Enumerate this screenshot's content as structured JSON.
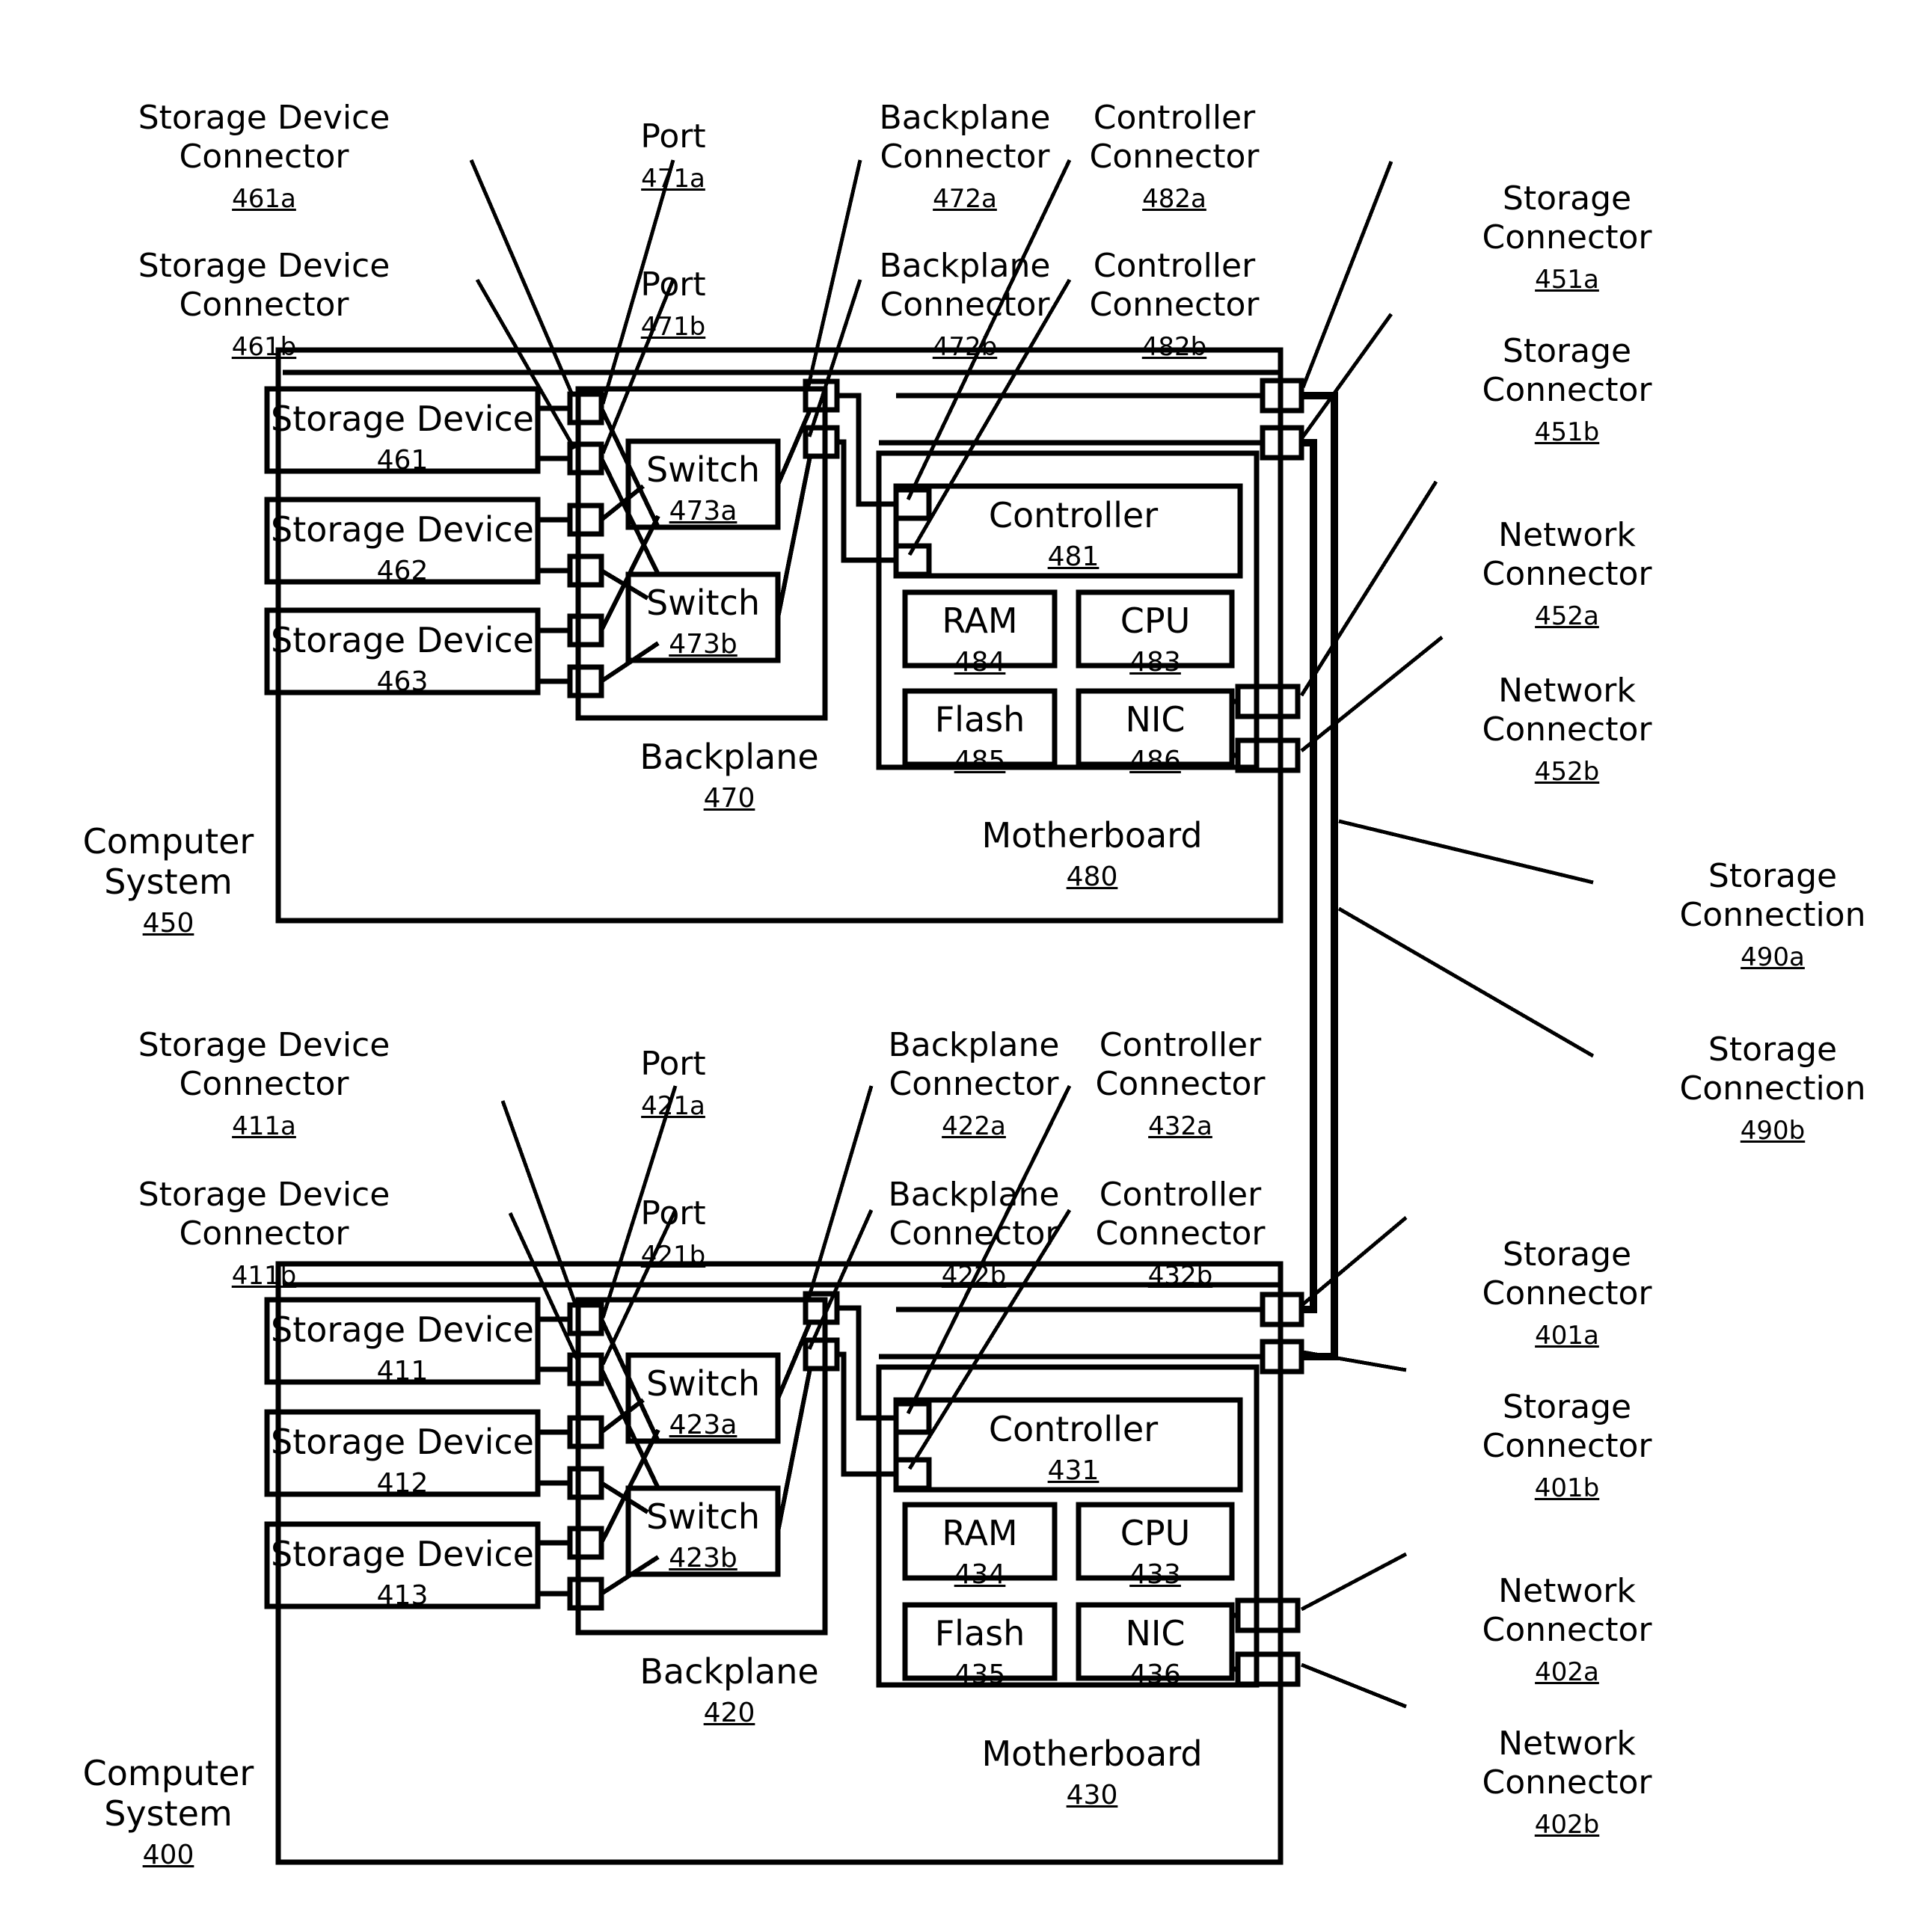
{
  "diagram": {
    "systems": [
      {
        "id": "system-450",
        "caption": "Computer\nSystem",
        "number": "450",
        "storage_devices": [
          {
            "label": "Storage Device",
            "number": "461"
          },
          {
            "label": "Storage Device",
            "number": "462"
          },
          {
            "label": "Storage Device",
            "number": "463"
          }
        ],
        "switches": [
          {
            "label": "Switch",
            "number": "473a"
          },
          {
            "label": "Switch",
            "number": "473b"
          }
        ],
        "backplane": {
          "label": "Backplane",
          "number": "470"
        },
        "motherboard": {
          "label": "Motherboard",
          "number": "480"
        },
        "controller": {
          "label": "Controller",
          "number": "481"
        },
        "chips": [
          {
            "label": "RAM",
            "number": "484"
          },
          {
            "label": "CPU",
            "number": "483"
          },
          {
            "label": "Flash",
            "number": "485"
          },
          {
            "label": "NIC",
            "number": "486"
          }
        ],
        "callouts": [
          {
            "label": "Storage Device\nConnector",
            "number": "461a"
          },
          {
            "label": "Storage Device\nConnector",
            "number": "461b"
          },
          {
            "label": "Port",
            "number": "471a"
          },
          {
            "label": "Port",
            "number": "471b"
          },
          {
            "label": "Backplane\nConnector",
            "number": "472a"
          },
          {
            "label": "Backplane\nConnector",
            "number": "472b"
          },
          {
            "label": "Controller\nConnector",
            "number": "482a"
          },
          {
            "label": "Controller\nConnector",
            "number": "482b"
          },
          {
            "label": "Storage\nConnector",
            "number": "451a"
          },
          {
            "label": "Storage\nConnector",
            "number": "451b"
          },
          {
            "label": "Network\nConnector",
            "number": "452a"
          },
          {
            "label": "Network\nConnector",
            "number": "452b"
          }
        ]
      },
      {
        "id": "system-400",
        "caption": "Computer\nSystem",
        "number": "400",
        "storage_devices": [
          {
            "label": "Storage Device",
            "number": "411"
          },
          {
            "label": "Storage Device",
            "number": "412"
          },
          {
            "label": "Storage Device",
            "number": "413"
          }
        ],
        "switches": [
          {
            "label": "Switch",
            "number": "423a"
          },
          {
            "label": "Switch",
            "number": "423b"
          }
        ],
        "backplane": {
          "label": "Backplane",
          "number": "420"
        },
        "motherboard": {
          "label": "Motherboard",
          "number": "430"
        },
        "controller": {
          "label": "Controller",
          "number": "431"
        },
        "chips": [
          {
            "label": "RAM",
            "number": "434"
          },
          {
            "label": "CPU",
            "number": "433"
          },
          {
            "label": "Flash",
            "number": "435"
          },
          {
            "label": "NIC",
            "number": "436"
          }
        ],
        "callouts": [
          {
            "label": "Storage Device\nConnector",
            "number": "411a"
          },
          {
            "label": "Storage Device\nConnector",
            "number": "411b"
          },
          {
            "label": "Port",
            "number": "421a"
          },
          {
            "label": "Port",
            "number": "421b"
          },
          {
            "label": "Backplane\nConnector",
            "number": "422a"
          },
          {
            "label": "Backplane\nConnector",
            "number": "422b"
          },
          {
            "label": "Controller\nConnector",
            "number": "432a"
          },
          {
            "label": "Controller\nConnector",
            "number": "432b"
          },
          {
            "label": "Storage\nConnector",
            "number": "401a"
          },
          {
            "label": "Storage\nConnector",
            "number": "401b"
          },
          {
            "label": "Network\nConnector",
            "number": "402a"
          },
          {
            "label": "Network\nConnector",
            "number": "402b"
          }
        ]
      }
    ],
    "interconnects": [
      {
        "label": "Storage\nConnection",
        "number": "490a"
      },
      {
        "label": "Storage\nConnection",
        "number": "490b"
      }
    ],
    "colors": {
      "ink": "#000000",
      "paper": "#ffffff"
    }
  }
}
